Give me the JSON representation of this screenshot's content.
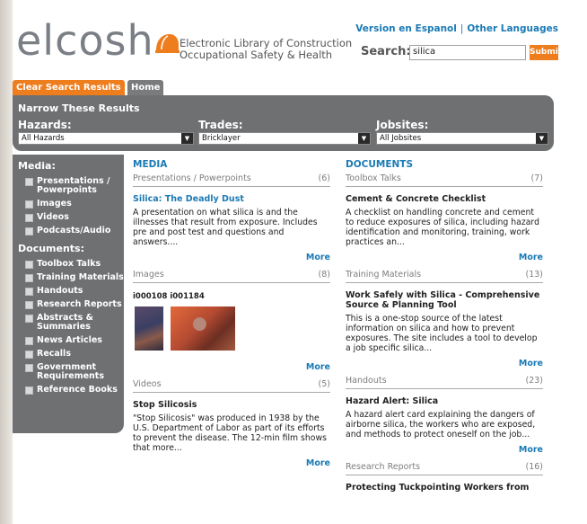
{
  "header": {
    "logo_text": "elcosh",
    "tagline_line1": "Electronic Library of Construction",
    "tagline_line2": "Occupational Safety & Health",
    "lang_spanish": "Version en Espanol",
    "lang_sep": "|",
    "lang_other": "Other Languages",
    "search_label": "Search:",
    "search_value": "silica",
    "search_submit": "Submit"
  },
  "tabs": {
    "clear": "Clear Search Results",
    "home": "Home"
  },
  "narrow": {
    "title": "Narrow These Results",
    "hazards_label": "Hazards:",
    "hazards_value": "All Hazards",
    "trades_label": "Trades:",
    "trades_value": "Bricklayer",
    "jobsites_label": "Jobsites:",
    "jobsites_value": "All Jobsites"
  },
  "sidebar": {
    "media_head": "Media:",
    "media_items": [
      "Presentations / Powerpoints",
      "Images",
      "Videos",
      "Podcasts/Audio"
    ],
    "docs_head": "Documents:",
    "doc_items": [
      "Toolbox Talks",
      "Training Materials",
      "Handouts",
      "Research Reports",
      "Abstracts & Summaries",
      "News Articles",
      "Recalls",
      "Government Requirements",
      "Reference Books"
    ]
  },
  "media": {
    "title": "MEDIA",
    "presentations": {
      "label": "Presentations / Powerpoints",
      "count": "(6)",
      "item_title": "Silica: The Deadly Dust",
      "item_desc": "A presentation on what silica is and the illnesses that result from exposure. Includes pre and post test and questions and answers....",
      "more": "More"
    },
    "images": {
      "label": "Images",
      "count": "(8)",
      "item_title": "i000108 i001184",
      "more": "More"
    },
    "videos": {
      "label": "Videos",
      "count": "(5)",
      "item_title": "Stop Silicosis",
      "item_desc": "\"Stop Silicosis\" was produced in 1938 by the U.S. Department of Labor as part of its efforts to prevent the disease. The 12-min film shows that more...",
      "more": "More"
    }
  },
  "documents": {
    "title": "DOCUMENTS",
    "toolbox": {
      "label": "Toolbox Talks",
      "count": "(7)",
      "item_title": "Cement & Concrete Checklist",
      "item_desc": "A checklist on handling concrete and cement to reduce exposures of silica, including hazard identification and monitoring, training, work practices an...",
      "more": "More"
    },
    "training": {
      "label": "Training Materials",
      "count": "(13)",
      "item_title": "Work Safely with Silica - Comprehensive Source & Planning Tool",
      "item_desc": "This is a one-stop source of the latest information on silica and how to prevent exposures. The site includes a tool to develop a job specific silica...",
      "more": "More"
    },
    "handouts": {
      "label": "Handouts",
      "count": "(23)",
      "item_title": "Hazard Alert: Silica",
      "item_desc": "A hazard alert card explaining the dangers of airborne silica, the workers who are exposed, and methods to protect oneself on the job...",
      "more": "More"
    },
    "research": {
      "label": "Research Reports",
      "count": "(16)",
      "item_title": "Protecting Tuckpointing Workers from"
    }
  }
}
